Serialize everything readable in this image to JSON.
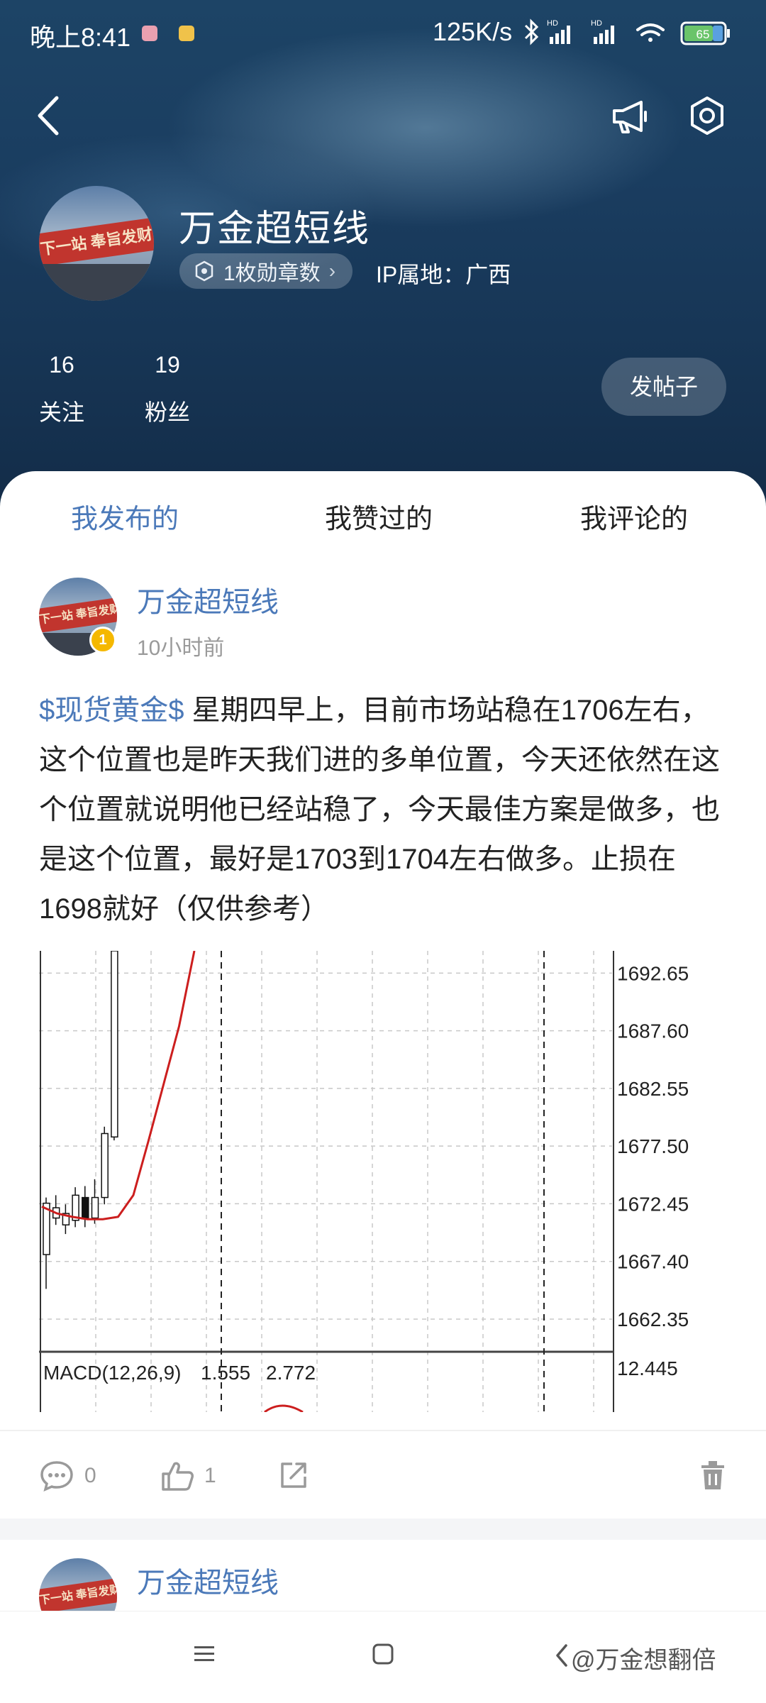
{
  "status_bar": {
    "time": "晚上8:41",
    "net_speed": "125K/s",
    "battery": "65"
  },
  "profile": {
    "name": "万金超短线",
    "medal_label": "1枚勋章数",
    "ip_location": "IP属地：广西",
    "following_count": "16",
    "following_label": "关注",
    "followers_count": "19",
    "followers_label": "粉丝",
    "post_button": "发帖子",
    "avatar_banner": "下一站  奉旨发财"
  },
  "tabs": [
    {
      "label": "我发布的",
      "active": true
    },
    {
      "label": "我赞过的",
      "active": false
    },
    {
      "label": "我评论的",
      "active": false
    }
  ],
  "post": {
    "author": "万金超短线",
    "level": "1",
    "time": "10小时前",
    "tag": "$现货黄金$",
    "content": " 星期四早上，目前市场站稳在1706左右，这个位置也是昨天我们进的多单位置，今天还依然在这个位置就说明他已经站稳了，今天最佳方案是做多，也是这个位置，最好是1703到1704左右做多。止损在1698就好（仅供参考）",
    "comments": "0",
    "likes": "1"
  },
  "next_post": {
    "author": "万金超短线"
  },
  "watermark": "@万金想翻倍",
  "chart_data": {
    "type": "line",
    "title": "",
    "price_ticks": [
      "1692.65",
      "1687.60",
      "1682.55",
      "1677.50",
      "1672.45",
      "1667.40",
      "1662.35"
    ],
    "ylim": [
      1659.8,
      1694.6
    ],
    "candles": [
      {
        "open": 1668.0,
        "close": 1672.5,
        "high": 1673.0,
        "low": 1665.0
      },
      {
        "open": 1671.2,
        "close": 1672.1,
        "high": 1673.2,
        "low": 1670.6
      },
      {
        "open": 1670.6,
        "close": 1671.6,
        "high": 1672.4,
        "low": 1669.8
      },
      {
        "open": 1671.0,
        "close": 1673.2,
        "high": 1673.9,
        "low": 1670.4
      },
      {
        "open": 1673.0,
        "close": 1671.2,
        "high": 1674.0,
        "low": 1670.4
      },
      {
        "open": 1671.2,
        "close": 1673.0,
        "high": 1674.6,
        "low": 1670.7
      },
      {
        "open": 1673.0,
        "close": 1678.6,
        "high": 1679.2,
        "low": 1672.4
      },
      {
        "open": 1678.3,
        "close": 1694.6,
        "high": 1694.6,
        "low": 1678.0
      }
    ],
    "ma_line": [
      1672.2,
      1671.6,
      1671.3,
      1671.1,
      1671.1,
      1671.3,
      1673.2,
      1678.0,
      1683.0,
      1688.0,
      1694.6
    ],
    "macd_label": "MACD(12,26,9)",
    "macd_values": [
      "1.555",
      "2.772"
    ],
    "macd_tick": "12.445",
    "grid": true
  }
}
